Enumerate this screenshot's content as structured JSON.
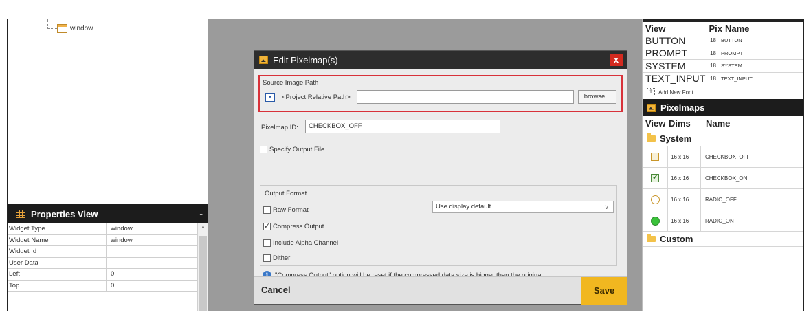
{
  "tree": {
    "item_label": "window"
  },
  "properties": {
    "title": "Properties View",
    "minimize": "-",
    "rows": [
      {
        "key": "Widget Type",
        "value": "window"
      },
      {
        "key": "Widget Name",
        "value": "window"
      },
      {
        "key": "Widget Id",
        "value": ""
      },
      {
        "key": "User Data",
        "value": ""
      },
      {
        "key": "Left",
        "value": "0"
      },
      {
        "key": "Top",
        "value": "0"
      }
    ],
    "scroll_up": "^"
  },
  "dialog": {
    "title": "Edit Pixelmap(s)",
    "close": "x",
    "source_label": "Source Image Path",
    "path_mode": "<Project Relative Path>",
    "path_value": "",
    "browse": "browse...",
    "pixelmap_id_label": "Pixelmap ID:",
    "pixelmap_id_value": "CHECKBOX_OFF",
    "specify_output": "Specify Output File",
    "output_format_label": "Output Format",
    "raw_format": "Raw Format",
    "format_select": "Use display default",
    "compress_output": "Compress Output",
    "include_alpha": "Include Alpha Channel",
    "dither": "Dither",
    "info_text": "\"Compress Output\" option will be reset if the compressed data size is bigger than the original.",
    "cancel": "Cancel",
    "save": "Save"
  },
  "fonts": {
    "col_view": "View",
    "col_pix": "Pix",
    "col_name": "Name",
    "rows": [
      {
        "view": "BUTTON",
        "pix": "18",
        "name": "BUTTON"
      },
      {
        "view": "PROMPT",
        "pix": "18",
        "name": "PROMPT"
      },
      {
        "view": "SYSTEM",
        "pix": "18",
        "name": "SYSTEM"
      },
      {
        "view": "TEXT_INPUT",
        "pix": "18",
        "name": "TEXT_INPUT"
      }
    ],
    "add_new": "Add New Font"
  },
  "pixelmaps": {
    "title": "Pixelmaps",
    "col_view": "View",
    "col_dims": "Dims",
    "col_name": "Name",
    "system_folder": "System",
    "custom_folder": "Custom",
    "rows": [
      {
        "icon": "checkbox-off-icon",
        "dims": "16 x 16",
        "name": "CHECKBOX_OFF"
      },
      {
        "icon": "checkbox-on-icon",
        "dims": "16 x 16",
        "name": "CHECKBOX_ON"
      },
      {
        "icon": "radio-off-icon",
        "dims": "16 x 16",
        "name": "RADIO_OFF"
      },
      {
        "icon": "radio-on-icon",
        "dims": "16 x 16",
        "name": "RADIO_ON"
      }
    ]
  },
  "colors": {
    "highlight_border": "#d8323a",
    "save_button": "#f1b720",
    "close_button": "#d32a1f"
  }
}
